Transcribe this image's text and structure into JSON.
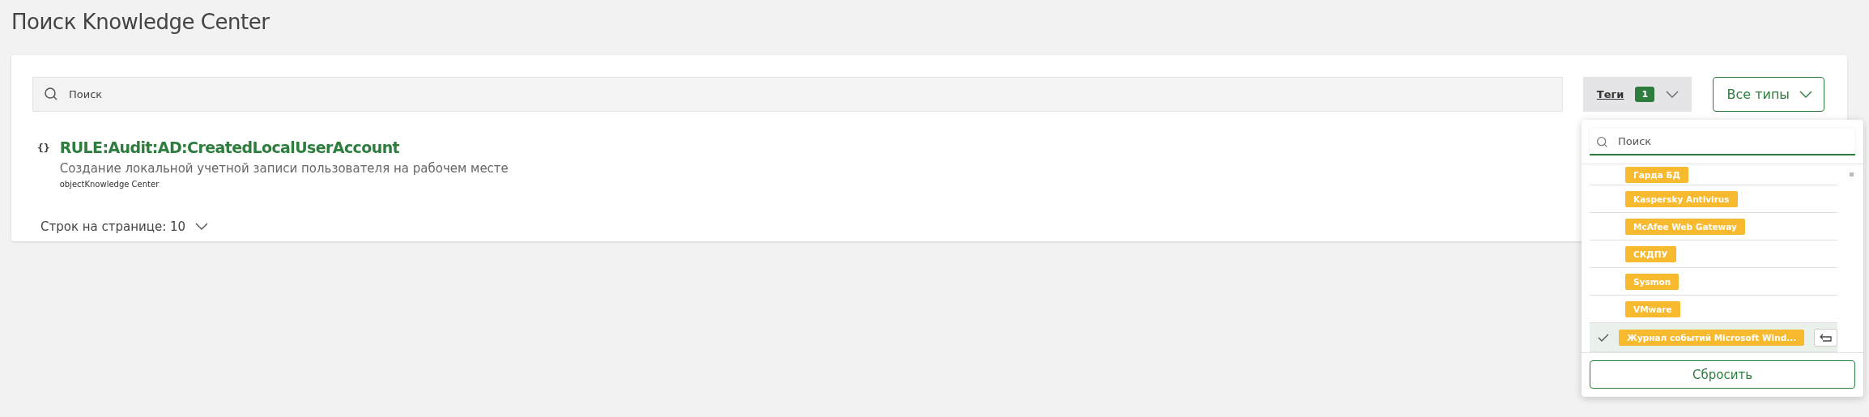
{
  "page_title": "Поиск Knowledge Center",
  "search": {
    "placeholder": "Поиск"
  },
  "tags_filter": {
    "label": "Теги",
    "count": "1",
    "expanded": true
  },
  "type_filter": {
    "label": "Все типы"
  },
  "results": [
    {
      "icon": "{}",
      "title": "RULE:Audit:AD:CreatedLocalUserAccount",
      "description": "Создание локальной учетной записи пользователя на рабочем месте",
      "source": "objectKnowledge Center"
    }
  ],
  "rows_per_page": {
    "label": "Строк на странице: 10"
  },
  "tags_dropdown": {
    "search": {
      "placeholder": "Поиск"
    },
    "tags": [
      {
        "label": "Гарда БД",
        "selected": false
      },
      {
        "label": "Kaspersky Antivirus",
        "selected": false
      },
      {
        "label": "McAfee Web Gateway",
        "selected": false
      },
      {
        "label": "СКДПУ",
        "selected": false
      },
      {
        "label": "Sysmon",
        "selected": false
      },
      {
        "label": "VMware",
        "selected": false
      },
      {
        "label": "Журнал событий Microsoft Wind...",
        "selected": true
      }
    ],
    "reset_button": "Сбросить"
  }
}
